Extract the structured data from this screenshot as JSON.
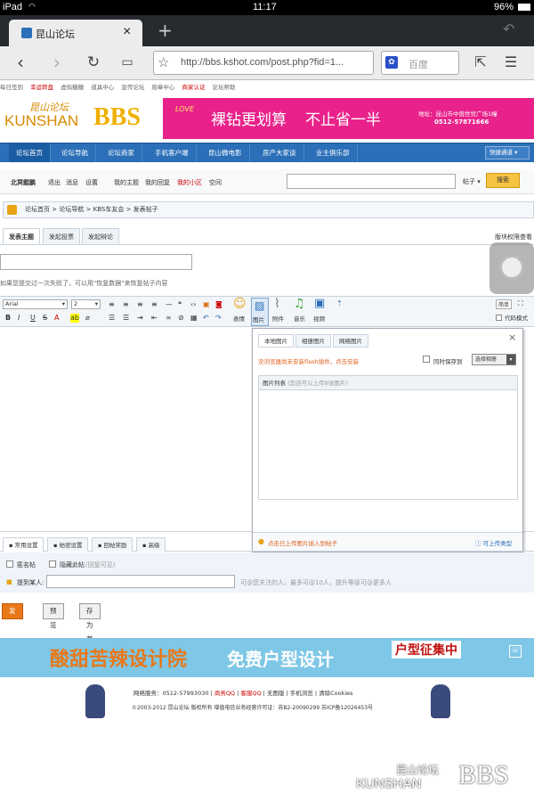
{
  "statusbar": {
    "device": "iPad",
    "time": "11:17",
    "battery": "96%"
  },
  "tab": {
    "title": "昆山论坛",
    "close": "×",
    "new": "+"
  },
  "browser": {
    "url": "http://bbs.kshot.com/post.php?fid=1...",
    "search_placeholder": "百度"
  },
  "toplinks": [
    "每日签到",
    "幸运转盘",
    "虚拟糖糖",
    "道具中心",
    "宣传论坛",
    "勋章中心",
    "商家认证",
    "论坛帮助"
  ],
  "logo": {
    "cn": "昆山论坛",
    "en": "KUNSHAN",
    "bbs": "BBS"
  },
  "banner1": {
    "slogan1": "裸钻更划算",
    "slogan2": "不止省一半",
    "addr": "地址：昆山市中茵世贸广场1幢",
    "phone": "0512-57871666",
    "brand": "LOVE"
  },
  "mainnav": [
    "论坛首页",
    "论坛导航",
    "论坛商家",
    "手机客户端",
    "昆山微电影",
    "房产大家谈",
    "业主俱乐部"
  ],
  "quicknav": "快捷通道",
  "subnav": {
    "user": "北冥鲲鹏",
    "links": [
      "退出",
      "消息",
      "设置",
      "我的主题",
      "我的回复",
      "我的小区",
      "空间"
    ],
    "search_type": "帖子",
    "search_btn": "搜索"
  },
  "breadcrumb": "论坛首页 > 论坛导航 > KBS车友会 > 发表帖子",
  "post_tabs": [
    "发表主题",
    "发起投票",
    "发起辩论"
  ],
  "perm_link": "版块权限查看",
  "notice": "如果您提交过一次失败了，可以用\"恢复数据\"来恢复帖子内容",
  "toolbar": {
    "font": "Arial",
    "size": "2",
    "labels": [
      "表情",
      "图片",
      "附件",
      "音乐",
      "视频"
    ],
    "simple": "简单",
    "code_mode": "代码模式"
  },
  "popup": {
    "tabs": [
      "本地图片",
      "相册图片",
      "网络图片"
    ],
    "flash_notice": "没浏览器尚未安装flash插件，点击安装",
    "save_to": "同时保存到",
    "album": "选择相册",
    "list_title": "图片列表",
    "list_hint": "(您还可以上传8张图片)",
    "insert_hint": "点击已上传图片插入到帖子",
    "upload_hint": "可上传类型"
  },
  "settings_tabs": [
    "常用设置",
    "帖密设置",
    "回帖奖励",
    "高级"
  ],
  "options": {
    "anon": "匿名帖",
    "hidden": "隐藏此帖",
    "hidden_note": "(回复可见)",
    "mention": "提到某人:",
    "mention_hint": "可@您关注的人，最多可@10人，提升等级可@更多人"
  },
  "buttons": [
    "发 布",
    "预 览",
    "存为草稿"
  ],
  "banner2": {
    "left": "酸甜苦辣设计院",
    "mid": "免费户型设计",
    "right": "户型征集中"
  },
  "footer": {
    "line1": [
      "网络服务：0512-57993030",
      "商务QQ",
      "客服QQ",
      "无图版",
      "手机浏览",
      "清除Cookies"
    ],
    "line2": "©2003-2012 昆山论坛 版权所有 增值电信业务经营许可证：苏B2-20090299 苏ICP备12026453号"
  },
  "watermark": {
    "cn": "昆山论坛",
    "en": "KUNSHAN",
    "bbs": "BBS"
  }
}
